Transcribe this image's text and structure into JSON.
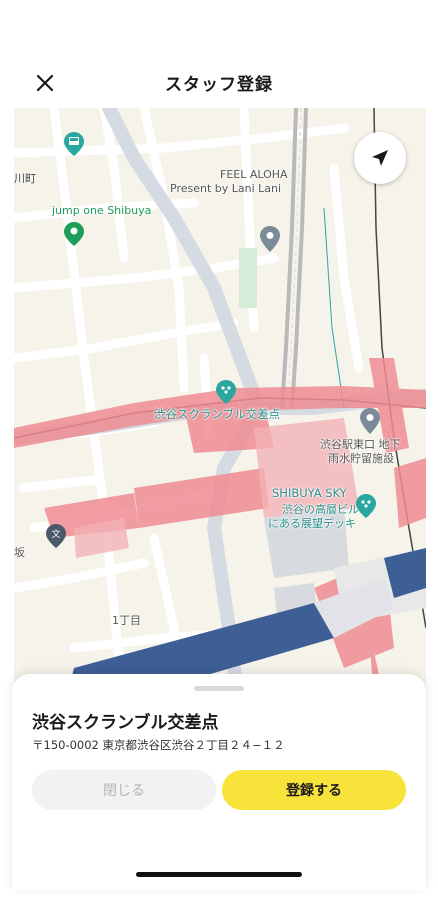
{
  "header": {
    "title": "スタッフ登録",
    "close_icon": "close-icon"
  },
  "map": {
    "labels": {
      "kawa_cho": "川町",
      "jump_one": "jump one Shibuya",
      "feel_aloha_1": "FEEL ALOHA",
      "feel_aloha_2": "Present by Lani Lani",
      "scramble": "渋谷スクランブル交差点",
      "station_east_1": "渋谷駅東口 地下",
      "station_east_2": "雨水貯留施設",
      "shibuya_sky": "SHIBUYA SKY",
      "sky_desc_1": "渋谷の高層ビル",
      "sky_desc_2": "にある展望デッキ",
      "saka": "坂",
      "chome": "1丁目"
    },
    "locate_icon": "navigation-arrow-icon",
    "colors": {
      "base": "#f6f3ea",
      "road": "#ffffff",
      "major_road": "#d5dbe2",
      "station": "#f08c93",
      "rail_blue": "#3e5f96",
      "park_green": "#1f9d5a",
      "teal_pin": "#2aa7a0"
    }
  },
  "sheet": {
    "place_name": "渋谷スクランブル交差点",
    "address": "〒150-0002 東京都渋谷区渋谷２丁目２４−１２",
    "close_label": "閉じる",
    "register_label": "登録する",
    "register_color": "#f8e33a"
  }
}
